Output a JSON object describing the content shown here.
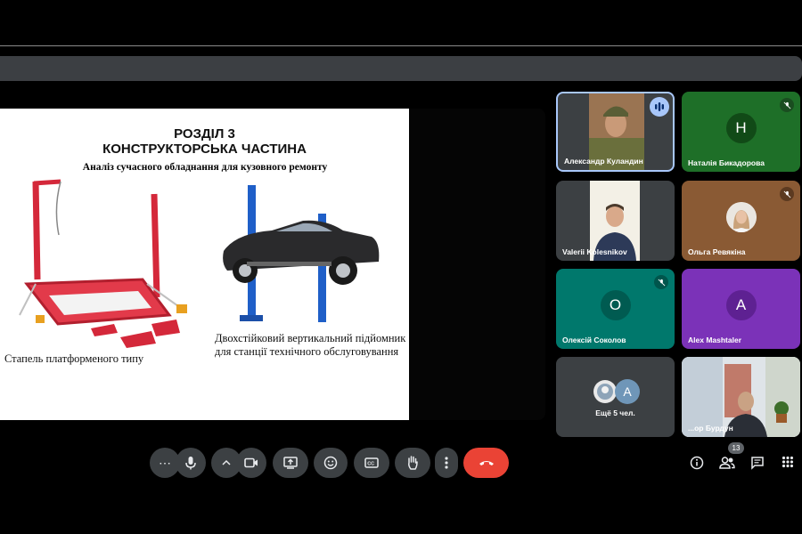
{
  "slide": {
    "title_line1": "РОЗДІЛ 3",
    "title_line2": "КОНСТРУКТОРСЬКА ЧАСТИНА",
    "subtitle": "Аналіз сучасного обладнання для кузовного ремонту",
    "caption_left": "Стапель платформеного типу",
    "caption_right_line1": "Двохстійковий вертикальний підйомник",
    "caption_right_line2": "для станції технічного обслуговування"
  },
  "participants": [
    {
      "name": "Александр Куландин",
      "type": "video",
      "state": "speaking"
    },
    {
      "name": "Наталія Бикадорова",
      "type": "initial",
      "initial": "Н",
      "bg": "#1e6f28",
      "avatar_bg": "#114a17",
      "state": "muted"
    },
    {
      "name": "Valerii Kolesnikov",
      "type": "video",
      "state": ""
    },
    {
      "name": "Ольга Ревякіна",
      "type": "photo",
      "bg": "#8a5a34",
      "state": "muted"
    },
    {
      "name": "Олексій Соколов",
      "type": "initial",
      "initial": "О",
      "bg": "#00786c",
      "avatar_bg": "#005b51",
      "state": "muted"
    },
    {
      "name": "Alex Mashtaler",
      "type": "initial",
      "initial": "A",
      "bg": "#7b32b8",
      "avatar_bg": "#5e2192",
      "state": ""
    },
    {
      "name": "Ещё 5 чел.",
      "type": "more",
      "initial": "A",
      "bg": "#3c4043",
      "state": ""
    },
    {
      "name": "...ор Бурдун",
      "type": "video",
      "state": ""
    }
  ],
  "toolbar": {
    "people_count": "13",
    "icons": [
      "more-options-icon",
      "microphone-icon",
      "chevron-up-icon",
      "camera-icon",
      "present-screen-icon",
      "emoji-icon",
      "captions-icon",
      "raise-hand-icon",
      "more-vert-icon",
      "end-call-icon",
      "info-icon",
      "people-icon",
      "chat-icon",
      "activities-icon"
    ]
  },
  "colors": {
    "end_call": "#ea4335",
    "button": "#3c4043",
    "tile": "#3c4043",
    "speaking_border": "#a8c7fa"
  }
}
